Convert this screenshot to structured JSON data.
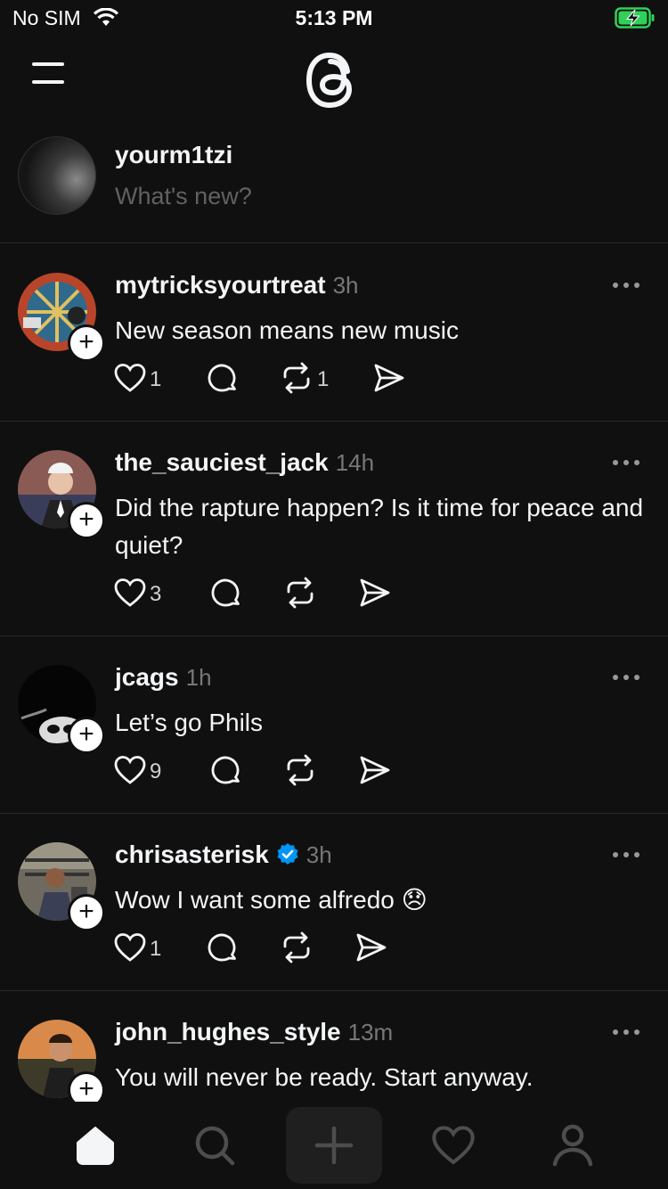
{
  "status_bar": {
    "carrier": "No SIM",
    "time": "5:13 PM",
    "battery": "charging"
  },
  "header": {
    "menu_icon": "hamburger-icon",
    "logo_icon": "threads-logo-icon"
  },
  "composer": {
    "username": "yourm1tzi",
    "placeholder": "What's new?"
  },
  "posts": [
    {
      "username": "mytricksyourtreat",
      "time": "3h",
      "verified": false,
      "text": "New season means new music",
      "likes": "1",
      "replies": "",
      "reposts": "1"
    },
    {
      "username": "the_sauciest_jack",
      "time": "14h",
      "verified": false,
      "text": "Did the rapture happen? Is it time for peace and quiet?",
      "likes": "3",
      "replies": "",
      "reposts": ""
    },
    {
      "username": "jcags",
      "time": "1h",
      "verified": false,
      "text": "Let’s go Phils",
      "likes": "9",
      "replies": "",
      "reposts": ""
    },
    {
      "username": "chrisasterisk",
      "time": "3h",
      "verified": true,
      "text": "Wow I want some alfredo 😞",
      "likes": "1",
      "replies": "",
      "reposts": ""
    },
    {
      "username": "john_hughes_style",
      "time": "13m",
      "verified": false,
      "text": "You will never be ready. Start anyway.",
      "likes": "",
      "replies": "",
      "reposts": ""
    }
  ],
  "tabbar": {
    "items": [
      "home-icon",
      "search-icon",
      "plus-icon",
      "heart-icon",
      "profile-icon"
    ],
    "active": "home-icon"
  },
  "colors": {
    "background": "#101010",
    "text": "#f3f5f7",
    "muted": "#777777",
    "verified": "#0095f6"
  }
}
